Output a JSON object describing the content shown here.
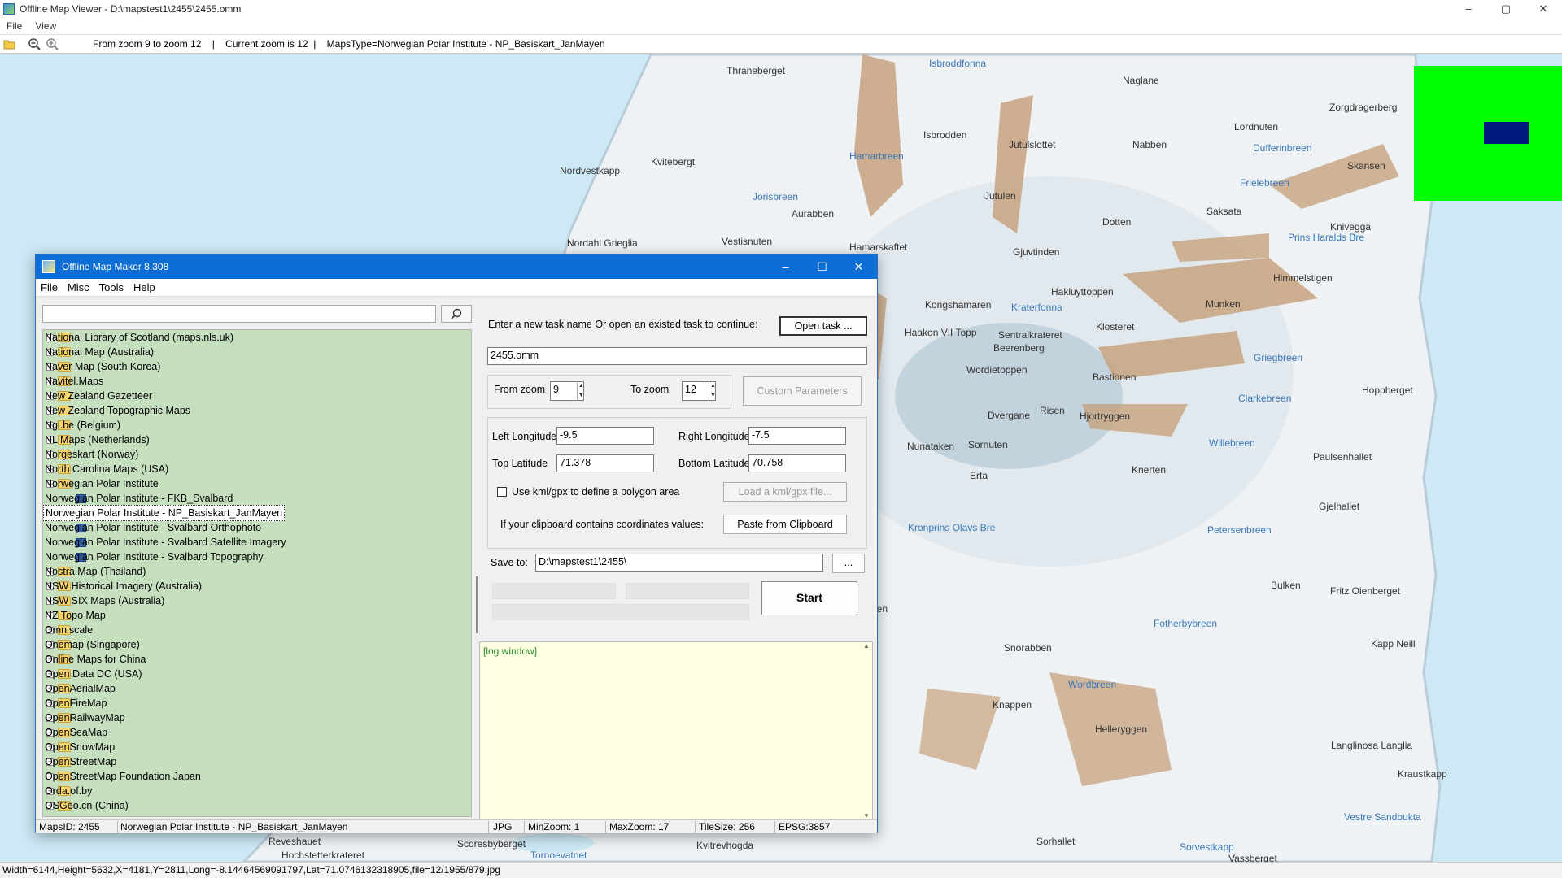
{
  "viewer": {
    "title": "Offline Map Viewer - D:\\mapstest1\\2455\\2455.omm",
    "menu": [
      "File",
      "View"
    ],
    "toolbar_info": "From zoom 9 to zoom 12    |    Current zoom is 12  |    MapsType=Norwegian Polar Institute - NP_Basiskart_JanMayen",
    "window_controls": {
      "minimize": "–",
      "maximize": "▢",
      "close": "✕"
    },
    "status": "Width=6144,Height=5632,X=4181,Y=2811,Long=-8.14464569091797,Lat=71.0746132318905,file=12/1955/879.jpg"
  },
  "map": {
    "colors": {
      "sea": "#cde9f6",
      "land": "#eef2f4",
      "coast": "#c9d6df",
      "mountain": "#c7a27e",
      "overview": "#00ff00",
      "viewport": "#001a80"
    },
    "labels": [
      {
        "text": "Thraneberget",
        "blue": false
      },
      {
        "text": "Isbroddfonna",
        "blue": true
      },
      {
        "text": "Naglane",
        "blue": false
      },
      {
        "text": "Kvitebergt",
        "blue": false
      },
      {
        "text": "Isbrodden",
        "blue": false
      },
      {
        "text": "Jutulslottet",
        "blue": false
      },
      {
        "text": "Nabben",
        "blue": false
      },
      {
        "text": "Lordnuten",
        "blue": false
      },
      {
        "text": "Zorgdragerberg",
        "blue": false
      },
      {
        "text": "Nordvestkapp",
        "blue": false
      },
      {
        "text": "Hamarbreen",
        "blue": true
      },
      {
        "text": "Dufferinbreen",
        "blue": true
      },
      {
        "text": "Skansen",
        "blue": false
      },
      {
        "text": "Frielebreen",
        "blue": true
      },
      {
        "text": "Jutulen",
        "blue": false
      },
      {
        "text": "Saksata",
        "blue": false
      },
      {
        "text": "Jorisbreen",
        "blue": true
      },
      {
        "text": "Aurabben",
        "blue": false
      },
      {
        "text": "Dotten",
        "blue": false
      },
      {
        "text": "Kniveggа",
        "blue": false
      },
      {
        "text": "Nordahl Grieglia",
        "blue": false
      },
      {
        "text": "Vestisnuten",
        "blue": false
      },
      {
        "text": "Prins Haralds Bre",
        "blue": true
      },
      {
        "text": "Hamarskaftet",
        "blue": false
      },
      {
        "text": "Gjuvtinden",
        "blue": false
      },
      {
        "text": "Himmelstigen",
        "blue": false
      },
      {
        "text": "Hakluyttoppen",
        "blue": false
      },
      {
        "text": "Kongshamaren",
        "blue": false
      },
      {
        "text": "Munken",
        "blue": false
      },
      {
        "text": "Kraterfonna",
        "blue": true
      },
      {
        "text": "Haakon VII Topp",
        "blue": false
      },
      {
        "text": "Sentralkrateret",
        "blue": false
      },
      {
        "text": "Klosteret",
        "blue": false
      },
      {
        "text": "Beerenberg",
        "blue": false
      },
      {
        "text": "Griegbreen",
        "blue": true
      },
      {
        "text": "Wordietoppen",
        "blue": false
      },
      {
        "text": "Hoppberget",
        "blue": false
      },
      {
        "text": "Bastionen",
        "blue": false
      },
      {
        "text": "Clarkebreen",
        "blue": true
      },
      {
        "text": "Dvergane",
        "blue": false
      },
      {
        "text": "Risen",
        "blue": false
      },
      {
        "text": "Hjortryggen",
        "blue": false
      },
      {
        "text": "Nunataken",
        "blue": false
      },
      {
        "text": "Sornuten",
        "blue": false
      },
      {
        "text": "Willebreen",
        "blue": true
      },
      {
        "text": "Paulsenhallet",
        "blue": false
      },
      {
        "text": "Erta",
        "blue": false
      },
      {
        "text": "Knerten",
        "blue": false
      },
      {
        "text": "Gjelhallet",
        "blue": false
      },
      {
        "text": "Kronprins Olavs Bre",
        "blue": true
      },
      {
        "text": "Petersenbreen",
        "blue": true
      },
      {
        "text": "Bulken",
        "blue": false
      },
      {
        "text": "Fritz Oienberget",
        "blue": false
      },
      {
        "text": "Fotherbybreen",
        "blue": true
      },
      {
        "text": "Kapp Neill",
        "blue": false
      },
      {
        "text": "Snorabben",
        "blue": false
      },
      {
        "text": "Wordbreen",
        "blue": true
      },
      {
        "text": "Knappen",
        "blue": false
      },
      {
        "text": "Helleryggen",
        "blue": false
      },
      {
        "text": "Langlinosa Langlia",
        "blue": false
      },
      {
        "text": "Kraustkapp",
        "blue": false
      },
      {
        "text": "Vestre Sandbukta",
        "blue": true
      },
      {
        "text": "Reveshauet",
        "blue": false
      },
      {
        "text": "Hochstetterkrateret",
        "blue": false
      },
      {
        "text": "Scoresbyberget",
        "blue": false
      },
      {
        "text": "Tornoevatnet",
        "blue": true
      },
      {
        "text": "Kvitrevhogda",
        "blue": false
      },
      {
        "text": "Sorhallet",
        "blue": false
      },
      {
        "text": "Vassberget",
        "blue": false
      },
      {
        "text": "Sorvestkapp",
        "blue": true
      },
      {
        "text": "ben",
        "blue": false
      }
    ]
  },
  "dialog": {
    "title": "Offline Map Maker 8.308",
    "menu": [
      "File",
      "Misc",
      "Tools",
      "Help"
    ],
    "window_controls": {
      "minimize": "–",
      "maximize": "☐",
      "close": "✕"
    },
    "search": {
      "value": "",
      "placeholder": ""
    },
    "tree": [
      {
        "label": "National Library of Scotland (maps.nls.uk)",
        "type": "folder"
      },
      {
        "label": "National Map (Australia)",
        "type": "folder"
      },
      {
        "label": "Naver Map (South Korea)",
        "type": "folder"
      },
      {
        "label": "Navitel.Maps",
        "type": "folder"
      },
      {
        "label": "New Zealand Gazetteer",
        "type": "folder"
      },
      {
        "label": "New Zealand Topographic Maps",
        "type": "folder"
      },
      {
        "label": "Ngi.be (Belgium)",
        "type": "folder"
      },
      {
        "label": "NL Maps (Netherlands)",
        "type": "folder"
      },
      {
        "label": "Norgeskart (Norway)",
        "type": "folder"
      },
      {
        "label": "North Carolina Maps (USA)",
        "type": "folder"
      },
      {
        "label": "Norwegian Polar Institute",
        "type": "folder-open"
      },
      {
        "label": "Norwegian Polar Institute - FKB_Svalbard",
        "type": "map"
      },
      {
        "label": "Norwegian Polar Institute - NP_Basiskart_JanMayen",
        "type": "map",
        "selected": true
      },
      {
        "label": "Norwegian Polar Institute - Svalbard Orthophoto",
        "type": "map"
      },
      {
        "label": "Norwegian Polar Institute - Svalbard Satellite Imagery",
        "type": "map"
      },
      {
        "label": "Norwegian Polar Institute - Svalbard Topography",
        "type": "map"
      },
      {
        "label": "Nostra Map (Thailand)",
        "type": "folder"
      },
      {
        "label": "NSW Historical Imagery (Australia)",
        "type": "folder"
      },
      {
        "label": "NSW SIX Maps (Australia)",
        "type": "folder"
      },
      {
        "label": "NZ Topo Map",
        "type": "folder"
      },
      {
        "label": "Omniscale",
        "type": "folder"
      },
      {
        "label": "Onemap (Singapore)",
        "type": "folder"
      },
      {
        "label": "Online Maps for China",
        "type": "folder"
      },
      {
        "label": "Open Data DC (USA)",
        "type": "folder"
      },
      {
        "label": "OpenAerialMap",
        "type": "folder"
      },
      {
        "label": "OpenFireMap",
        "type": "folder"
      },
      {
        "label": "OpenRailwayMap",
        "type": "folder"
      },
      {
        "label": "OpenSeaMap",
        "type": "folder"
      },
      {
        "label": "OpenSnowMap",
        "type": "folder"
      },
      {
        "label": "OpenStreetMap",
        "type": "folder"
      },
      {
        "label": "OpenStreetMap Foundation Japan",
        "type": "folder"
      },
      {
        "label": "Orda.of.by",
        "type": "folder"
      },
      {
        "label": "OSGeo.cn (China)",
        "type": "folder"
      }
    ],
    "task_label": "Enter a new task name Or open an existed task to continue:",
    "open_task_button": "Open task ...",
    "task_name": "2455.omm",
    "from_zoom_label": "From zoom",
    "from_zoom": "9",
    "to_zoom_label": "To zoom",
    "to_zoom": "12",
    "custom_params_button": "Custom Parameters",
    "left_lon_label": "Left Longitude",
    "left_lon": "-9.5",
    "right_lon_label": "Right Longitude",
    "right_lon": "-7.5",
    "top_lat_label": "Top Latitude",
    "top_lat": "71.378",
    "bottom_lat_label": "Bottom Latitude",
    "bottom_lat": "70.758",
    "kml_checkbox_label": "Use kml/gpx to define a polygon area",
    "load_kml_button": "Load a kml/gpx file...",
    "clipboard_label": "If your clipboard contains coordinates values:",
    "paste_button": "Paste from Clipboard",
    "save_to_label": "Save to:",
    "save_to": "D:\\mapstest1\\2455\\",
    "browse_button": "...",
    "start_button": "Start",
    "log_text": "[log window]",
    "status": {
      "maps_id": "MapsID: 2455",
      "maps_name": "Norwegian Polar Institute - NP_Basiskart_JanMayen",
      "format": "JPG",
      "min_zoom": "MinZoom: 1",
      "max_zoom": "MaxZoom: 17",
      "tile_size": "TileSize: 256",
      "epsg": "EPSG:3857"
    }
  }
}
